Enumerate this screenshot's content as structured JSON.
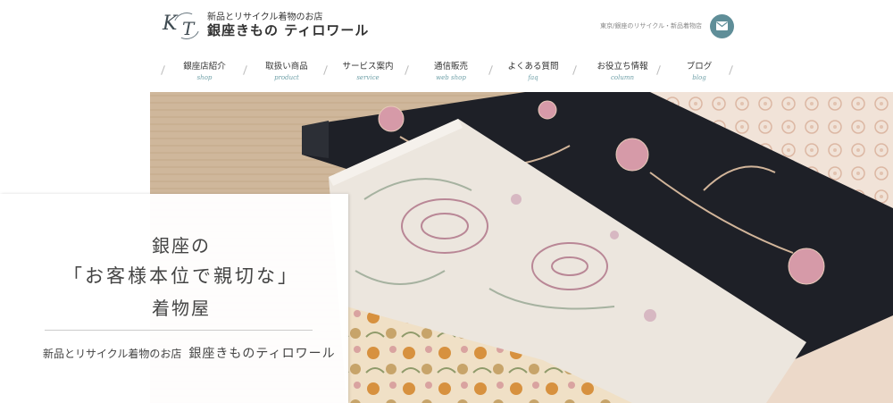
{
  "header": {
    "tagline": "新品とリサイクル着物のお店",
    "brand": "銀座きもの ティロワール",
    "logo_text": "KT",
    "note": "東京/銀座のリサイクル・新品着物店",
    "mail_icon": "envelope-icon",
    "accent_color": "#5f8e98"
  },
  "nav": {
    "items": [
      {
        "label": "銀座店紹介",
        "sub": "shop"
      },
      {
        "label": "取扱い商品",
        "sub": "product"
      },
      {
        "label": "サービス案内",
        "sub": "service"
      },
      {
        "label": "通信販売",
        "sub": "web shop"
      },
      {
        "label": "よくある質問",
        "sub": "faq"
      },
      {
        "label": "お役立ち情報",
        "sub": "column"
      },
      {
        "label": "ブログ",
        "sub": "blog"
      }
    ]
  },
  "hero": {
    "line1": "銀座の",
    "line2": "「お客様本位で親切な」",
    "line3": "着物屋",
    "sub_small": "新品とリサイクル着物のお店",
    "sub_large": "銀座きものティロワール"
  }
}
